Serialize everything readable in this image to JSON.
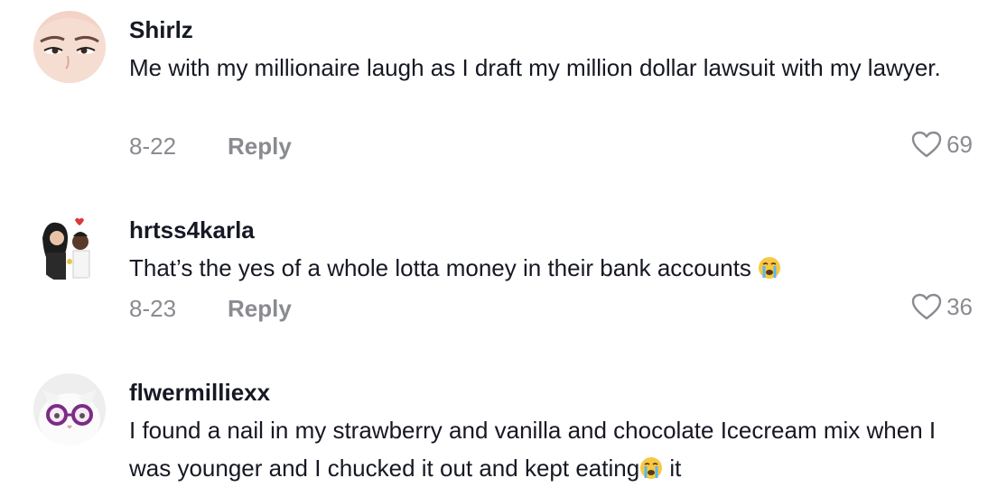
{
  "comments": [
    {
      "username": "Shirlz",
      "text": "Me with my millionaire laugh as I draft my million dollar lawsuit with my lawyer.",
      "date": "8-22",
      "reply_label": "Reply",
      "likes": "69",
      "avatar": "face-closeup-avatar"
    },
    {
      "username": "hrtss4karla",
      "text": "That’s the yes of a whole lotta money in their bank accounts",
      "emoji": "loudly-crying-face",
      "date": "8-23",
      "reply_label": "Reply",
      "likes": "36",
      "avatar": "couple-cartoon-avatar"
    },
    {
      "username": "flwermilliexx",
      "text_before_emoji": "I found a nail in my strawberry and vanilla and chocolate Icecream mix when I was younger and I chucked it out and kept eating",
      "emoji": "loudly-crying-face",
      "text_after_emoji": " it",
      "avatar": "cat-with-glasses-avatar"
    }
  ],
  "colors": {
    "text": "#161823",
    "muted": "#8a8b91",
    "background": "#ffffff"
  }
}
